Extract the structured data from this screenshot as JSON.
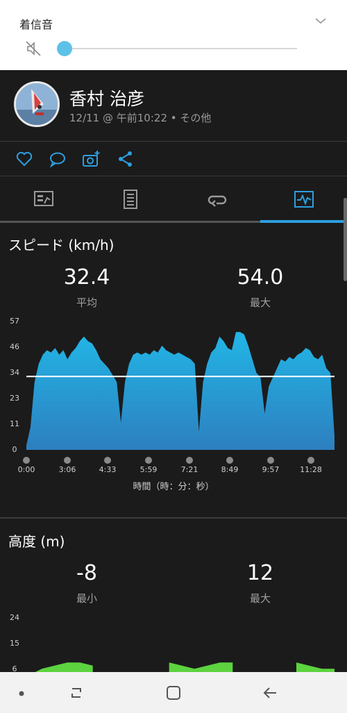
{
  "volume": {
    "title": "着信音",
    "level": 0.0
  },
  "activity": {
    "user_name": "香村 治彦",
    "meta": "12/11 @ 午前10:22 • その他"
  },
  "actions": {
    "icons": [
      "heart-icon",
      "comment-icon",
      "camera-add-icon",
      "share-icon"
    ]
  },
  "tabs": {
    "icons": [
      "summary-icon",
      "details-icon",
      "laps-icon",
      "chart-icon"
    ],
    "active_index": 3
  },
  "speed": {
    "title": "スピード (km/h)",
    "avg_value": "32.4",
    "avg_label": "平均",
    "max_value": "54.0",
    "max_label": "最大",
    "y_ticks": [
      "57",
      "46",
      "34",
      "23",
      "11",
      "0"
    ],
    "x_ticks": [
      "0:00",
      "3:06",
      "4:33",
      "5:59",
      "7:21",
      "8:49",
      "9:57",
      "11:28"
    ],
    "x_axis_label": "時間（時：分：秒）"
  },
  "altitude": {
    "title": "高度 (m)",
    "min_value": "-8",
    "min_label": "最小",
    "max_value": "12",
    "max_label": "最大",
    "y_ticks": [
      "24",
      "15",
      "6"
    ]
  },
  "colors": {
    "accent": "#2e9fe0",
    "speed_fill_top": "#22b6e6",
    "speed_fill_bottom": "#2d7fbf",
    "altitude_fill": "#5dd33f"
  },
  "chart_data": [
    {
      "type": "area",
      "title": "スピード (km/h)",
      "xlabel": "時間（時：分：秒）",
      "ylabel": "",
      "ylim": [
        0,
        57
      ],
      "x_ticks": [
        "0:00",
        "3:06",
        "4:33",
        "5:59",
        "7:21",
        "8:49",
        "9:57",
        "11:28"
      ],
      "reference_line": 32.4,
      "series": [
        {
          "values": [
            2,
            10,
            30,
            38,
            42,
            44,
            43,
            45,
            42,
            44,
            40,
            43,
            45,
            48,
            50,
            48,
            47,
            44,
            40,
            38,
            36,
            33,
            30,
            12,
            30,
            38,
            42,
            43,
            42,
            43,
            42,
            44,
            43,
            46,
            44,
            43,
            42,
            43,
            42,
            41,
            40,
            38,
            8,
            30,
            38,
            43,
            45,
            50,
            48,
            45,
            44,
            52,
            52,
            51,
            46,
            40,
            34,
            32,
            16,
            28,
            32,
            36,
            40,
            39,
            41,
            40,
            42,
            43,
            45,
            44,
            41,
            40,
            42,
            36,
            34,
            6
          ]
        }
      ]
    },
    {
      "type": "area",
      "title": "高度 (m)",
      "ylim": [
        0,
        24
      ],
      "series": [
        {
          "values": [
            6,
            8,
            9,
            10,
            10,
            9,
            null,
            null,
            null,
            null,
            null,
            10,
            9,
            8,
            9,
            10,
            10,
            null,
            null,
            null,
            null,
            10,
            9,
            8,
            8
          ]
        }
      ]
    }
  ]
}
